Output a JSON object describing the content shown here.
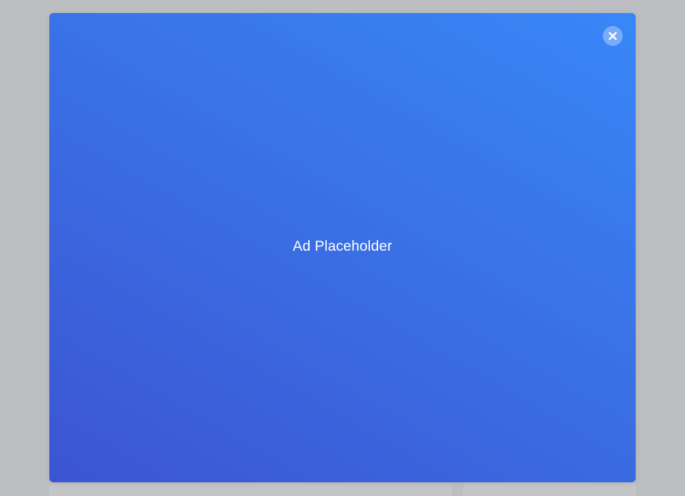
{
  "ad": {
    "placeholder_text": "Ad Placeholder",
    "close_icon": "close-icon",
    "gradient_colors": [
      "#3c55d2",
      "#3a6ee4",
      "#3887f8"
    ]
  },
  "backdrop": {
    "color": "#bdbec2"
  }
}
